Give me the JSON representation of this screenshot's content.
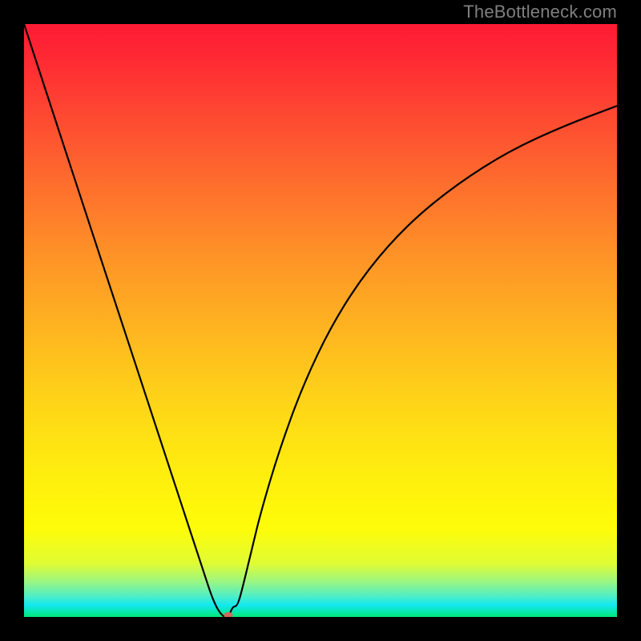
{
  "watermark": "TheBottleneck.com",
  "chart_data": {
    "type": "line",
    "title": "",
    "xlabel": "",
    "ylabel": "",
    "xlim": [
      0,
      1
    ],
    "ylim": [
      0,
      1
    ],
    "series": [
      {
        "name": "bottleneck-curve",
        "x": [
          0.0,
          0.05,
          0.1,
          0.15,
          0.2,
          0.25,
          0.3,
          0.32,
          0.335,
          0.345,
          0.352,
          0.36,
          0.37,
          0.385,
          0.4,
          0.43,
          0.47,
          0.52,
          0.58,
          0.65,
          0.73,
          0.82,
          0.91,
          1.0
        ],
        "y": [
          1.0,
          0.847,
          0.694,
          0.542,
          0.39,
          0.237,
          0.085,
          0.024,
          0.0,
          0.0,
          0.018,
          0.018,
          0.055,
          0.118,
          0.179,
          0.28,
          0.39,
          0.495,
          0.587,
          0.665,
          0.73,
          0.787,
          0.828,
          0.862
        ]
      }
    ],
    "marker": {
      "x": 0.345,
      "y": 0.0
    },
    "colors": {
      "curve": "#000000",
      "marker": "#d06a5c",
      "gradient_top": "#fe1a34",
      "gradient_bottom": "#00e876"
    }
  }
}
